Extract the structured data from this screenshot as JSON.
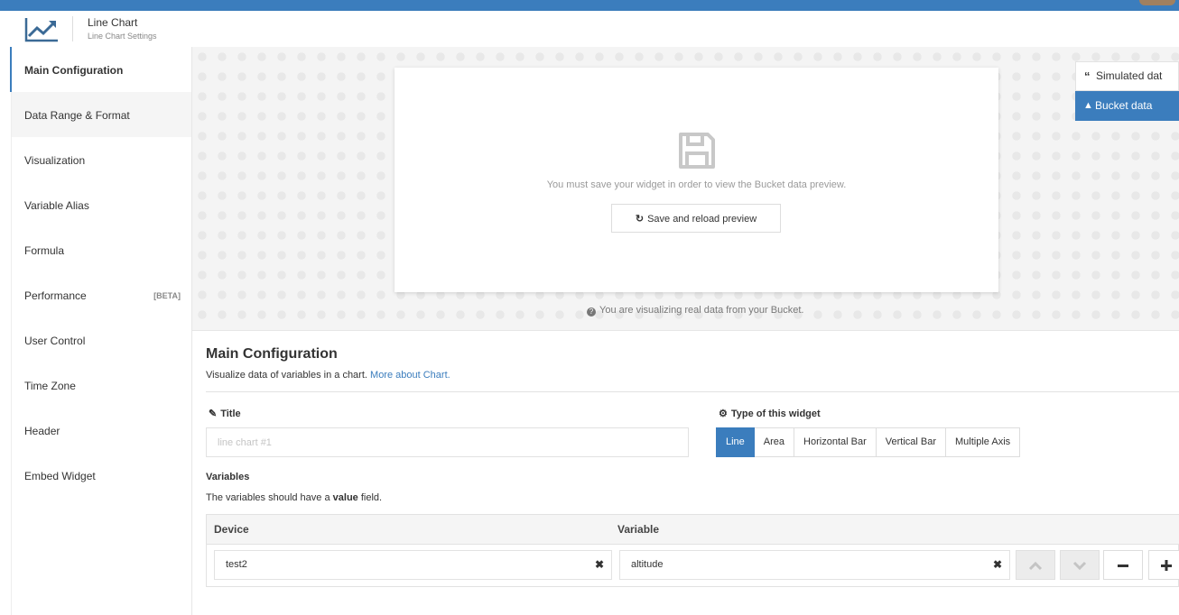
{
  "header": {
    "title": "Line Chart",
    "subtitle": "Line Chart Settings"
  },
  "sidebar": {
    "items": [
      {
        "label": "Main Configuration"
      },
      {
        "label": "Data Range & Format"
      },
      {
        "label": "Visualization"
      },
      {
        "label": "Variable Alias"
      },
      {
        "label": "Formula"
      },
      {
        "label": "Performance",
        "badge": "[BETA]"
      },
      {
        "label": "User Control"
      },
      {
        "label": "Time Zone"
      },
      {
        "label": "Header"
      },
      {
        "label": "Embed Widget"
      }
    ]
  },
  "preview": {
    "message": "You must save your widget in order to view the Bucket data preview.",
    "reload_label": "Save and reload preview",
    "info": "You are visualizing real data from your Bucket.",
    "tab_simulated": "Simulated dat",
    "tab_bucket": "Bucket data"
  },
  "config": {
    "title": "Main Configuration",
    "description": "Visualize data of variables in a chart.",
    "link": "More about Chart.",
    "title_label": "Title",
    "title_placeholder": "line chart #1",
    "type_label": "Type of this widget",
    "types": [
      "Line",
      "Area",
      "Horizontal Bar",
      "Vertical Bar",
      "Multiple Axis"
    ],
    "variables_label": "Variables",
    "variables_desc_pre": "The variables should have a",
    "variables_desc_bold": "value",
    "variables_desc_post": "field.",
    "col_device": "Device",
    "col_variable": "Variable",
    "device_value": "test2",
    "variable_value": "altitude"
  },
  "colors": {
    "accent": "#3b7dbd"
  }
}
